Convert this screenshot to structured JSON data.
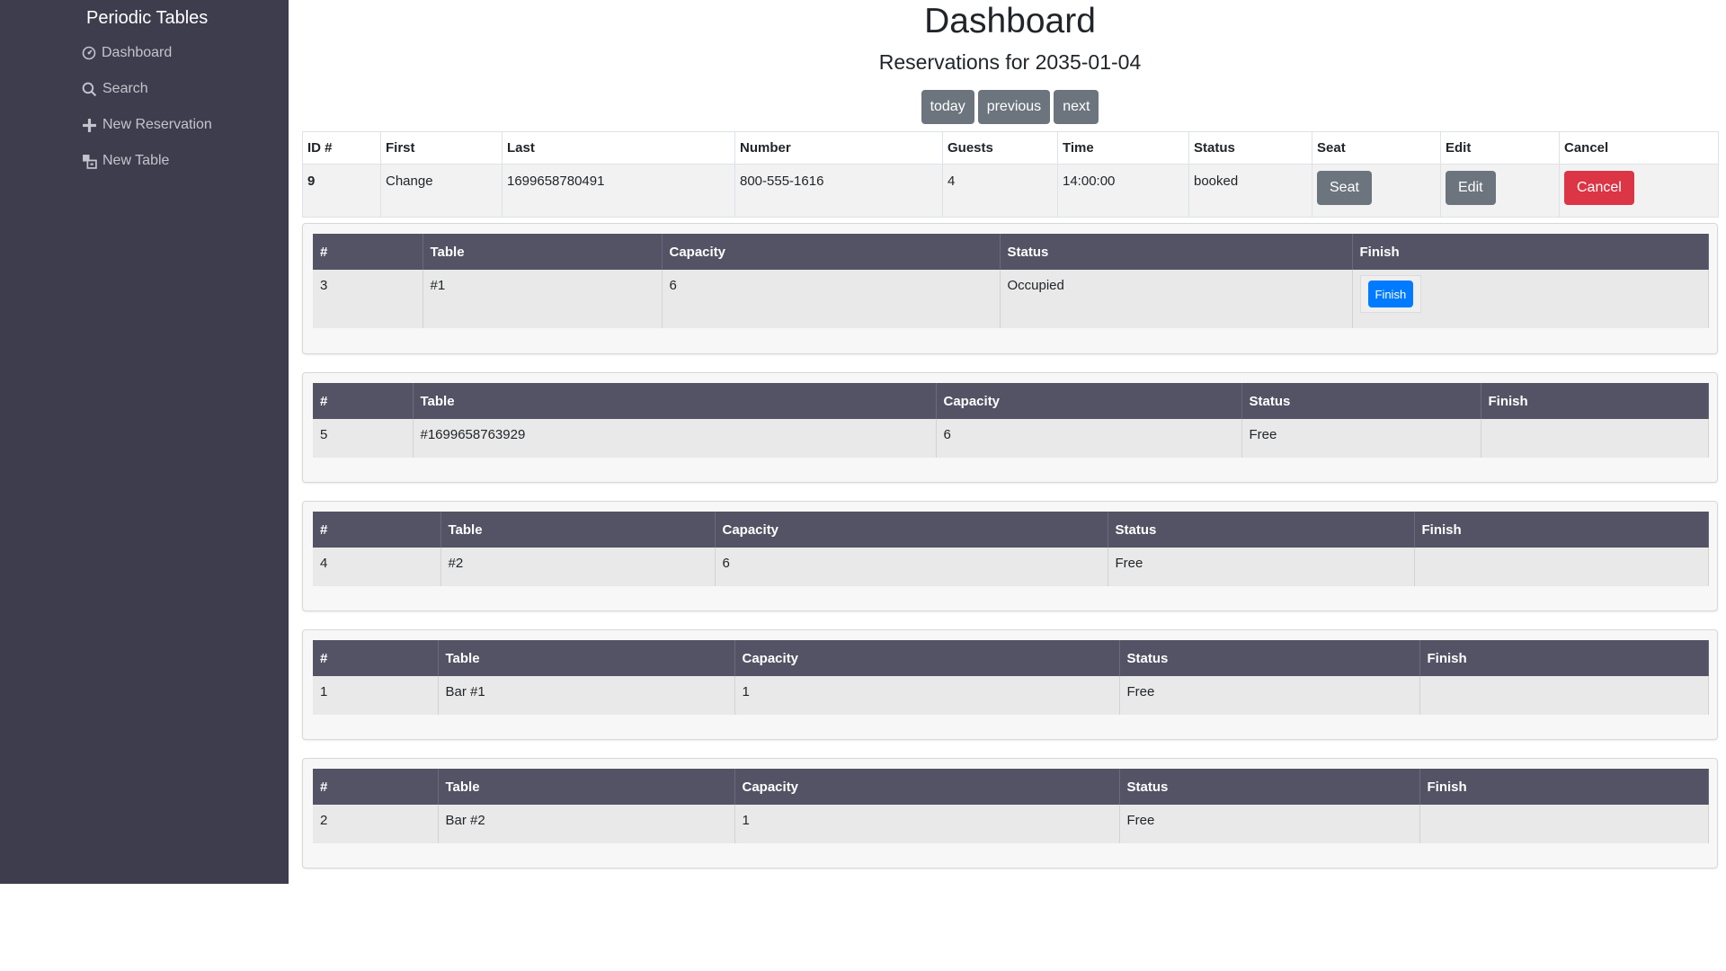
{
  "sidebar": {
    "brand": "Periodic Tables",
    "items": [
      {
        "label": "Dashboard",
        "icon": "dashboard-icon"
      },
      {
        "label": "Search",
        "icon": "search-icon"
      },
      {
        "label": "New Reservation",
        "icon": "plus-icon"
      },
      {
        "label": "New Table",
        "icon": "table-icon"
      }
    ]
  },
  "header": {
    "title": "Dashboard",
    "subtitle": "Reservations for 2035-01-04"
  },
  "date_nav": {
    "today": "today",
    "previous": "previous",
    "next": "next"
  },
  "reservations": {
    "columns": [
      "ID #",
      "First",
      "Last",
      "Number",
      "Guests",
      "Time",
      "Status",
      "Seat",
      "Edit",
      "Cancel"
    ],
    "rows": [
      {
        "id": "9",
        "first": "Change",
        "last": "1699658780491",
        "number": "800-555-1616",
        "guests": "4",
        "time": "14:00:00",
        "status": "booked",
        "seat_label": "Seat",
        "edit_label": "Edit",
        "cancel_label": "Cancel"
      }
    ]
  },
  "tables": {
    "columns": [
      "#",
      "Table",
      "Capacity",
      "Status",
      "Finish"
    ],
    "items": [
      {
        "id": "3",
        "name": "#1",
        "capacity": "6",
        "status": "Occupied",
        "finish_label": "Finish"
      },
      {
        "id": "5",
        "name": "#1699658763929",
        "capacity": "6",
        "status": "Free"
      },
      {
        "id": "4",
        "name": "#2",
        "capacity": "6",
        "status": "Free"
      },
      {
        "id": "1",
        "name": "Bar #1",
        "capacity": "1",
        "status": "Free"
      },
      {
        "id": "2",
        "name": "Bar #2",
        "capacity": "1",
        "status": "Free"
      }
    ]
  },
  "colors": {
    "sidebar_bg": "#3d3d4e",
    "table_header_bg": "#535365",
    "button_gray": "#6c757d",
    "button_red": "#dc3545",
    "button_blue": "#007bff"
  }
}
